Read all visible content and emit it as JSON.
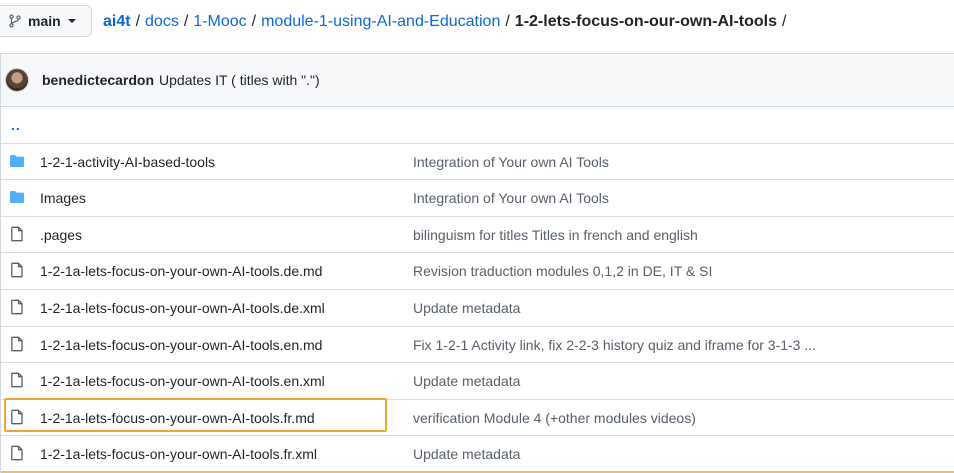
{
  "branch": {
    "label": "main"
  },
  "breadcrumb": {
    "repo": "ai4t",
    "path": [
      "docs",
      "1-Mooc",
      "module-1-using-AI-and-Education"
    ],
    "current": "1-2-lets-focus-on-our-own-AI-tools",
    "separator": "/"
  },
  "commit": {
    "author": "benedictecardon",
    "message": "Updates IT ( titles with \".\")"
  },
  "parent_link": "..",
  "files": [
    {
      "type": "folder",
      "name": "1-2-1-activity-AI-based-tools",
      "message": "Integration of Your own AI Tools"
    },
    {
      "type": "folder",
      "name": "Images",
      "message": "Integration of Your own AI Tools"
    },
    {
      "type": "file",
      "name": ".pages",
      "message": "bilinguism for titles Titles in french and english"
    },
    {
      "type": "file",
      "name": "1-2-1a-lets-focus-on-your-own-AI-tools.de.md",
      "message": "Revision traduction modules 0,1,2 in DE, IT & SI"
    },
    {
      "type": "file",
      "name": "1-2-1a-lets-focus-on-your-own-AI-tools.de.xml",
      "message": "Update metadata"
    },
    {
      "type": "file",
      "name": "1-2-1a-lets-focus-on-your-own-AI-tools.en.md",
      "message": "Fix 1-2-1 Activity link, fix 2-2-3 history quiz and iframe for 3-1-3 ..."
    },
    {
      "type": "file",
      "name": "1-2-1a-lets-focus-on-your-own-AI-tools.en.xml",
      "message": "Update metadata"
    },
    {
      "type": "file",
      "name": "1-2-1a-lets-focus-on-your-own-AI-tools.fr.md",
      "message": "verification Module 4 (+other modules videos)"
    },
    {
      "type": "file",
      "name": "1-2-1a-lets-focus-on-your-own-AI-tools.fr.xml",
      "message": "Update metadata"
    }
  ],
  "colors": {
    "link": "#0969da",
    "folder_icon": "#54aeff",
    "highlight_border": "#f0a33c"
  }
}
